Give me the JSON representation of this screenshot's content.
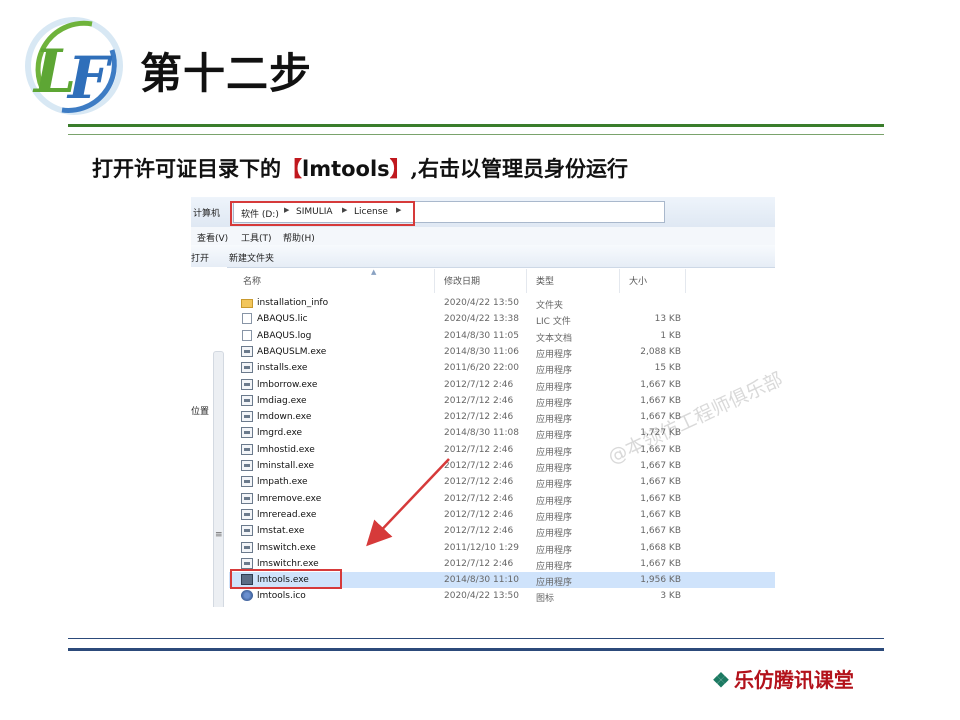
{
  "page": {
    "title": "第十二步",
    "instruction_before": "打开许可证目录下的",
    "instruction_bracket_open": "【",
    "instruction_highlight": "lmtools",
    "instruction_bracket_close": "】",
    "instruction_after": ",右击以管理员身份运行",
    "footer_mark": "❖",
    "footer": "乐仿腾讯课堂",
    "watermark": "@本领仿工程师俱乐部",
    "logo_letters": "LF"
  },
  "explorer": {
    "address_root": "计算机",
    "breadcrumbs": [
      "软件 (D:)",
      "SIMULIA",
      "License"
    ],
    "menu": [
      "查看(V)",
      "工具(T)",
      "帮助(H)"
    ],
    "toolbar": [
      "打开",
      "新建文件夹"
    ],
    "nav_items": [
      "位置",
      ":)"
    ],
    "columns": [
      "名称",
      "修改日期",
      "类型",
      "大小"
    ],
    "files": [
      {
        "name": "installation_info",
        "date": "2020/4/22 13:50",
        "type": "文件夹",
        "size": "",
        "icon": "folder-icon"
      },
      {
        "name": "ABAQUS.lic",
        "date": "2020/4/22 13:38",
        "type": "LIC 文件",
        "size": "13 KB",
        "icon": "document-icon"
      },
      {
        "name": "ABAQUS.log",
        "date": "2014/8/30 11:05",
        "type": "文本文档",
        "size": "1 KB",
        "icon": "document-icon"
      },
      {
        "name": "ABAQUSLM.exe",
        "date": "2014/8/30 11:06",
        "type": "应用程序",
        "size": "2,088 KB",
        "icon": "exe-icon"
      },
      {
        "name": "installs.exe",
        "date": "2011/6/20 22:00",
        "type": "应用程序",
        "size": "15 KB",
        "icon": "exe-icon"
      },
      {
        "name": "lmborrow.exe",
        "date": "2012/7/12 2:46",
        "type": "应用程序",
        "size": "1,667 KB",
        "icon": "exe-icon"
      },
      {
        "name": "lmdiag.exe",
        "date": "2012/7/12 2:46",
        "type": "应用程序",
        "size": "1,667 KB",
        "icon": "exe-icon"
      },
      {
        "name": "lmdown.exe",
        "date": "2012/7/12 2:46",
        "type": "应用程序",
        "size": "1,667 KB",
        "icon": "exe-icon"
      },
      {
        "name": "lmgrd.exe",
        "date": "2014/8/30 11:08",
        "type": "应用程序",
        "size": "1,727 KB",
        "icon": "exe-icon"
      },
      {
        "name": "lmhostid.exe",
        "date": "2012/7/12 2:46",
        "type": "应用程序",
        "size": "1,667 KB",
        "icon": "exe-icon"
      },
      {
        "name": "lminstall.exe",
        "date": "2012/7/12 2:46",
        "type": "应用程序",
        "size": "1,667 KB",
        "icon": "exe-icon"
      },
      {
        "name": "lmpath.exe",
        "date": "2012/7/12 2:46",
        "type": "应用程序",
        "size": "1,667 KB",
        "icon": "exe-icon"
      },
      {
        "name": "lmremove.exe",
        "date": "2012/7/12 2:46",
        "type": "应用程序",
        "size": "1,667 KB",
        "icon": "exe-icon"
      },
      {
        "name": "lmreread.exe",
        "date": "2012/7/12 2:46",
        "type": "应用程序",
        "size": "1,667 KB",
        "icon": "exe-icon"
      },
      {
        "name": "lmstat.exe",
        "date": "2012/7/12 2:46",
        "type": "应用程序",
        "size": "1,667 KB",
        "icon": "exe-icon"
      },
      {
        "name": "lmswitch.exe",
        "date": "2011/12/10 1:29",
        "type": "应用程序",
        "size": "1,668 KB",
        "icon": "exe-icon"
      },
      {
        "name": "lmswitchr.exe",
        "date": "2012/7/12 2:46",
        "type": "应用程序",
        "size": "1,667 KB",
        "icon": "exe-icon"
      },
      {
        "name": "lmtools.exe",
        "date": "2014/8/30 11:10",
        "type": "应用程序",
        "size": "1,956 KB",
        "icon": "lmtools-icon",
        "selected": true
      },
      {
        "name": "lmtools.ico",
        "date": "2020/4/22 13:50",
        "type": "图标",
        "size": "3 KB",
        "icon": "ico-file-icon"
      }
    ]
  },
  "colors": {
    "accent_green": "#3a7d2b",
    "rule_blue": "#2c4a7a",
    "highlight_red": "#c0181e",
    "annotation_red": "#d63a3a",
    "selection_blue": "#cfe3fb"
  }
}
